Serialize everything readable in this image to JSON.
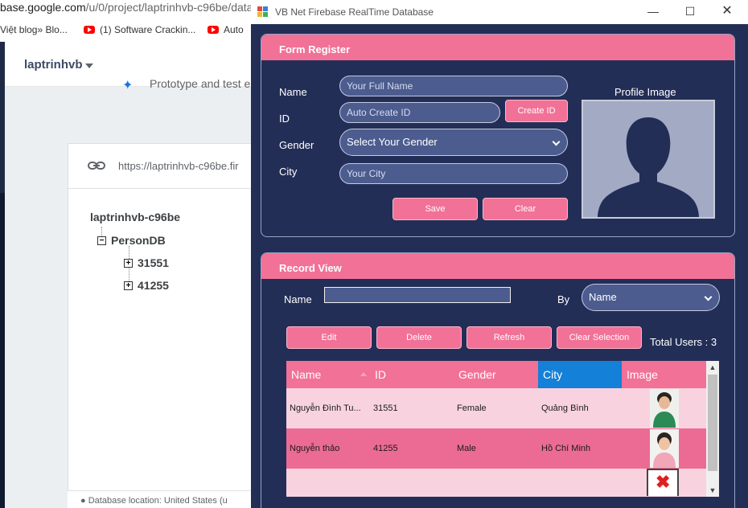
{
  "browser": {
    "address_domain": "base.google.com",
    "address_path": "/u/0/project/laptrinhvb-c96be/data",
    "bookmarks": [
      {
        "label": "Việt blog» Blo..."
      },
      {
        "label": "(1) Software Crackin..."
      },
      {
        "label": "Auto"
      }
    ],
    "project_name": "laptrinhvb",
    "prototype_text": "Prototype and test e",
    "db_url": "https://laptrinhvb-c96be.fir",
    "tree": {
      "root": "laptrinhvb-c96be",
      "child": "PersonDB",
      "children": [
        "31551",
        "41255"
      ]
    },
    "footer": "Database location: United States (u"
  },
  "window": {
    "title": "VB Net Firebase RealTime Database",
    "form_register": {
      "title": "Form Register",
      "labels": {
        "name": "Name",
        "id": "ID",
        "gender": "Gender",
        "city": "City"
      },
      "placeholders": {
        "name": "Your Full Name",
        "id": "Auto Create ID",
        "city": "Your City"
      },
      "gender_select": "Select Your Gender",
      "create_id": "Create ID",
      "save": "Save",
      "clear": "Clear",
      "profile_label": "Profile Image"
    },
    "record_view": {
      "title": "Record View",
      "name_label": "Name",
      "name_value": "",
      "by_label": "By",
      "by_select": "Name",
      "buttons": {
        "edit": "Edit",
        "delete": "Delete",
        "refresh": "Refresh",
        "clear_selection": "Clear Selection"
      },
      "total_users": "Total Users : 3",
      "columns": [
        "Name",
        "ID",
        "Gender",
        "City",
        "Image"
      ],
      "rows": [
        {
          "name": "Nguyễn Đình Tu...",
          "id": "31551",
          "gender": "Female",
          "city": "Quảng Bình"
        },
        {
          "name": "Nguyễn thảo",
          "id": "41255",
          "gender": "Male",
          "city": "Hồ Chí Minh"
        },
        {
          "name": "",
          "id": "",
          "gender": "",
          "city": ""
        }
      ]
    }
  },
  "colors": {
    "window_bg": "#232e57",
    "accent_pink": "#f27197",
    "active_column": "#1480d8",
    "row_alt": "#ec6b94"
  }
}
